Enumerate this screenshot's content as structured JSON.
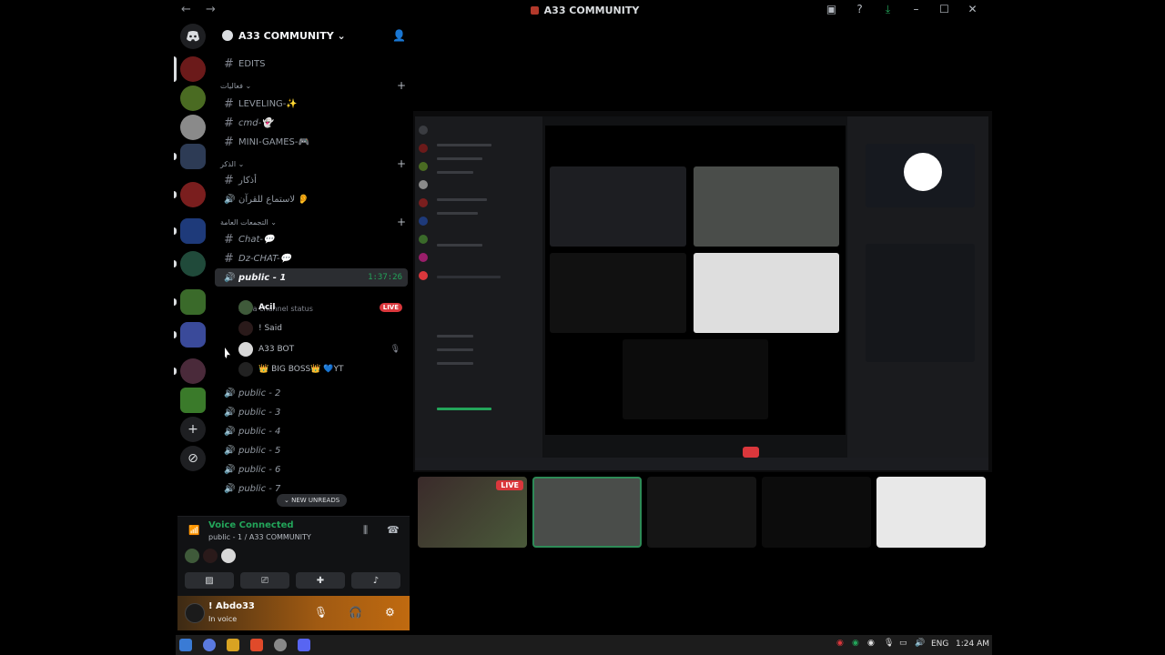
{
  "window": {
    "title": "A33 COMMUNITY",
    "nav_arrows": "←  →"
  },
  "server": {
    "name": "A33 COMMUNITY"
  },
  "channels": [
    {
      "type": "text",
      "name": "EDITS"
    },
    {
      "type": "category",
      "name": "فعاليات"
    },
    {
      "type": "text",
      "name": "LEVELING-✨"
    },
    {
      "type": "text",
      "name": "cmd-👻"
    },
    {
      "type": "text",
      "name": "MINI-GAMES-🎮"
    },
    {
      "type": "category",
      "name": "الذكر"
    },
    {
      "type": "text",
      "name": "أذكار"
    },
    {
      "type": "voice",
      "name": "لاستماع للقرآن 👂"
    },
    {
      "type": "category",
      "name": "التجمعات العامة"
    },
    {
      "type": "text",
      "name": "Chat-💬"
    },
    {
      "type": "text",
      "name": "Dz-CHAT-💬"
    },
    {
      "type": "voice",
      "name": "public - 1",
      "time": "1:37:26",
      "status": "Set a channel status"
    },
    {
      "type": "voice",
      "name": "public - 2"
    },
    {
      "type": "voice",
      "name": "public - 3"
    },
    {
      "type": "voice",
      "name": "public - 4"
    },
    {
      "type": "voice",
      "name": "public - 5"
    },
    {
      "type": "voice",
      "name": "public - 6"
    },
    {
      "type": "voice",
      "name": "public - 7"
    }
  ],
  "voice_users": [
    {
      "name": "Acil",
      "live": "LIVE"
    },
    {
      "name": "! Said"
    },
    {
      "name": "A33 BOT"
    },
    {
      "name": "👑 BIG BOSS👑 💙YT"
    }
  ],
  "new_unreads": "NEW UNREADS",
  "voice_panel": {
    "title": "Voice Connected",
    "subtitle": "public - 1 / A33 COMMUNITY"
  },
  "user_panel": {
    "name": "! Abdo33",
    "status": "In voice"
  },
  "thumbs": [
    {
      "label": "LIVE"
    }
  ],
  "taskbar": {
    "lang": "ENG",
    "time": "1:24 AM"
  },
  "colors": {
    "green": "#23a55a",
    "red": "#da373c",
    "bg": "#000000"
  }
}
